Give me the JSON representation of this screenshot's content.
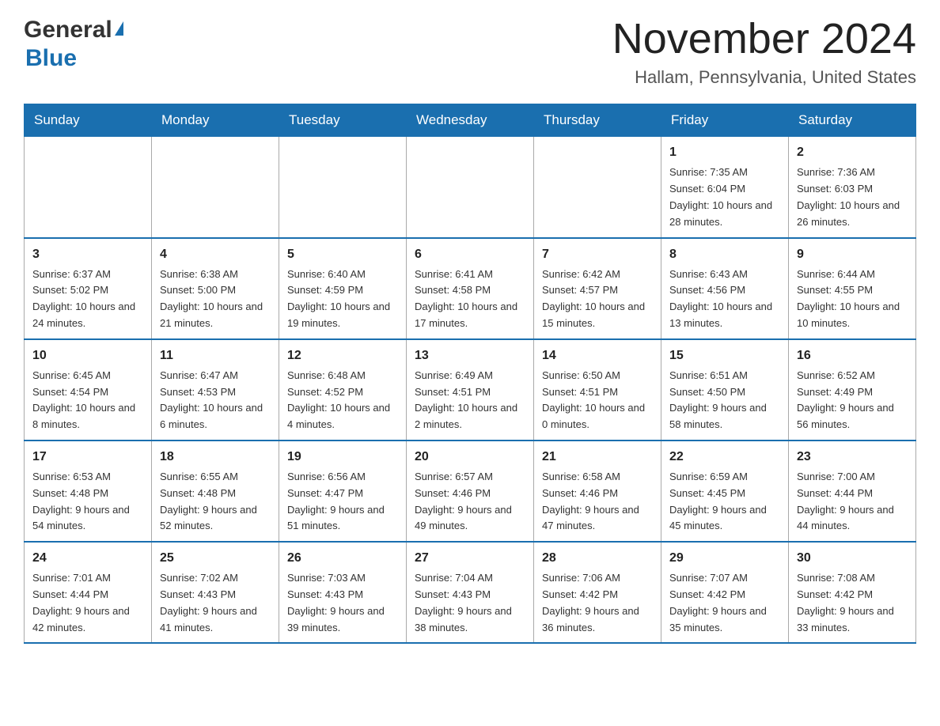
{
  "logo": {
    "general": "General",
    "blue": "Blue"
  },
  "title": "November 2024",
  "subtitle": "Hallam, Pennsylvania, United States",
  "days_header": [
    "Sunday",
    "Monday",
    "Tuesday",
    "Wednesday",
    "Thursday",
    "Friday",
    "Saturday"
  ],
  "weeks": [
    [
      {
        "day": "",
        "info": ""
      },
      {
        "day": "",
        "info": ""
      },
      {
        "day": "",
        "info": ""
      },
      {
        "day": "",
        "info": ""
      },
      {
        "day": "",
        "info": ""
      },
      {
        "day": "1",
        "info": "Sunrise: 7:35 AM\nSunset: 6:04 PM\nDaylight: 10 hours and 28 minutes."
      },
      {
        "day": "2",
        "info": "Sunrise: 7:36 AM\nSunset: 6:03 PM\nDaylight: 10 hours and 26 minutes."
      }
    ],
    [
      {
        "day": "3",
        "info": "Sunrise: 6:37 AM\nSunset: 5:02 PM\nDaylight: 10 hours and 24 minutes."
      },
      {
        "day": "4",
        "info": "Sunrise: 6:38 AM\nSunset: 5:00 PM\nDaylight: 10 hours and 21 minutes."
      },
      {
        "day": "5",
        "info": "Sunrise: 6:40 AM\nSunset: 4:59 PM\nDaylight: 10 hours and 19 minutes."
      },
      {
        "day": "6",
        "info": "Sunrise: 6:41 AM\nSunset: 4:58 PM\nDaylight: 10 hours and 17 minutes."
      },
      {
        "day": "7",
        "info": "Sunrise: 6:42 AM\nSunset: 4:57 PM\nDaylight: 10 hours and 15 minutes."
      },
      {
        "day": "8",
        "info": "Sunrise: 6:43 AM\nSunset: 4:56 PM\nDaylight: 10 hours and 13 minutes."
      },
      {
        "day": "9",
        "info": "Sunrise: 6:44 AM\nSunset: 4:55 PM\nDaylight: 10 hours and 10 minutes."
      }
    ],
    [
      {
        "day": "10",
        "info": "Sunrise: 6:45 AM\nSunset: 4:54 PM\nDaylight: 10 hours and 8 minutes."
      },
      {
        "day": "11",
        "info": "Sunrise: 6:47 AM\nSunset: 4:53 PM\nDaylight: 10 hours and 6 minutes."
      },
      {
        "day": "12",
        "info": "Sunrise: 6:48 AM\nSunset: 4:52 PM\nDaylight: 10 hours and 4 minutes."
      },
      {
        "day": "13",
        "info": "Sunrise: 6:49 AM\nSunset: 4:51 PM\nDaylight: 10 hours and 2 minutes."
      },
      {
        "day": "14",
        "info": "Sunrise: 6:50 AM\nSunset: 4:51 PM\nDaylight: 10 hours and 0 minutes."
      },
      {
        "day": "15",
        "info": "Sunrise: 6:51 AM\nSunset: 4:50 PM\nDaylight: 9 hours and 58 minutes."
      },
      {
        "day": "16",
        "info": "Sunrise: 6:52 AM\nSunset: 4:49 PM\nDaylight: 9 hours and 56 minutes."
      }
    ],
    [
      {
        "day": "17",
        "info": "Sunrise: 6:53 AM\nSunset: 4:48 PM\nDaylight: 9 hours and 54 minutes."
      },
      {
        "day": "18",
        "info": "Sunrise: 6:55 AM\nSunset: 4:48 PM\nDaylight: 9 hours and 52 minutes."
      },
      {
        "day": "19",
        "info": "Sunrise: 6:56 AM\nSunset: 4:47 PM\nDaylight: 9 hours and 51 minutes."
      },
      {
        "day": "20",
        "info": "Sunrise: 6:57 AM\nSunset: 4:46 PM\nDaylight: 9 hours and 49 minutes."
      },
      {
        "day": "21",
        "info": "Sunrise: 6:58 AM\nSunset: 4:46 PM\nDaylight: 9 hours and 47 minutes."
      },
      {
        "day": "22",
        "info": "Sunrise: 6:59 AM\nSunset: 4:45 PM\nDaylight: 9 hours and 45 minutes."
      },
      {
        "day": "23",
        "info": "Sunrise: 7:00 AM\nSunset: 4:44 PM\nDaylight: 9 hours and 44 minutes."
      }
    ],
    [
      {
        "day": "24",
        "info": "Sunrise: 7:01 AM\nSunset: 4:44 PM\nDaylight: 9 hours and 42 minutes."
      },
      {
        "day": "25",
        "info": "Sunrise: 7:02 AM\nSunset: 4:43 PM\nDaylight: 9 hours and 41 minutes."
      },
      {
        "day": "26",
        "info": "Sunrise: 7:03 AM\nSunset: 4:43 PM\nDaylight: 9 hours and 39 minutes."
      },
      {
        "day": "27",
        "info": "Sunrise: 7:04 AM\nSunset: 4:43 PM\nDaylight: 9 hours and 38 minutes."
      },
      {
        "day": "28",
        "info": "Sunrise: 7:06 AM\nSunset: 4:42 PM\nDaylight: 9 hours and 36 minutes."
      },
      {
        "day": "29",
        "info": "Sunrise: 7:07 AM\nSunset: 4:42 PM\nDaylight: 9 hours and 35 minutes."
      },
      {
        "day": "30",
        "info": "Sunrise: 7:08 AM\nSunset: 4:42 PM\nDaylight: 9 hours and 33 minutes."
      }
    ]
  ]
}
